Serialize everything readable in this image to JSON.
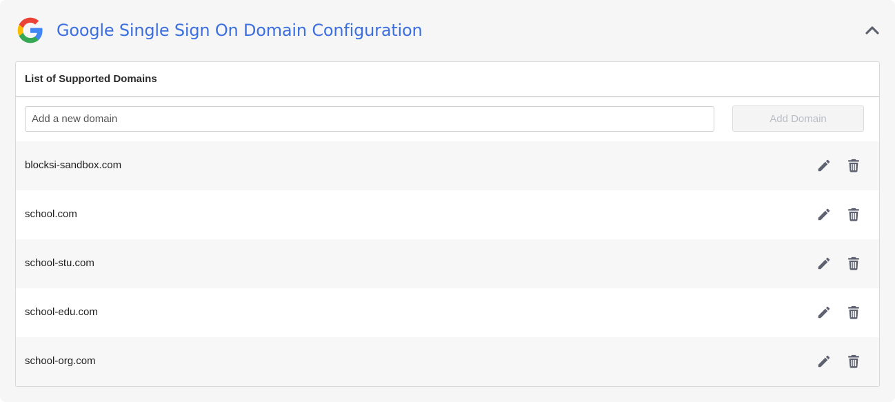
{
  "header": {
    "title": "Google Single Sign On Domain Configuration",
    "logo_icon": "google-logo-icon",
    "collapse_icon": "chevron-up-icon"
  },
  "card": {
    "title": "List of Supported Domains"
  },
  "add_form": {
    "input_placeholder": "Add a new domain",
    "input_value": "",
    "button_label": "Add Domain",
    "button_disabled": true
  },
  "domains": [
    {
      "name": "blocksi-sandbox.com"
    },
    {
      "name": "school.com"
    },
    {
      "name": "school-stu.com"
    },
    {
      "name": "school-edu.com"
    },
    {
      "name": "school-org.com"
    }
  ],
  "row_actions": {
    "edit_icon": "pencil-icon",
    "delete_icon": "trash-icon"
  },
  "colors": {
    "title": "#3b6fe0",
    "icon": "#5d6170",
    "google_blue": "#4285f4",
    "google_red": "#ea4335",
    "google_yellow": "#fbbc05",
    "google_green": "#34a853"
  }
}
